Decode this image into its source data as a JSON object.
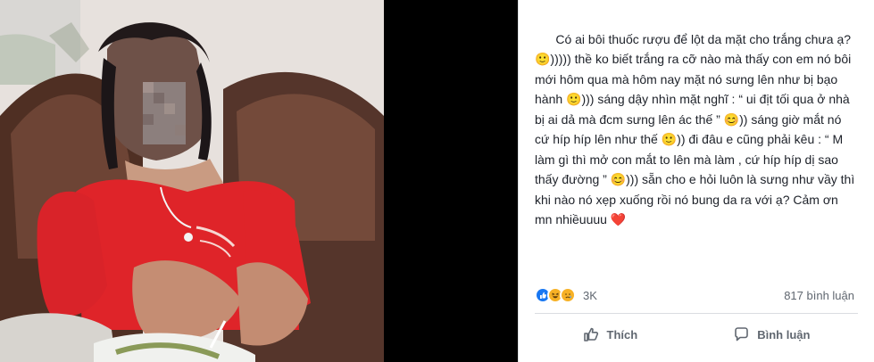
{
  "post": {
    "text_main": "Có ai bôi thuốc rượu để lột da mặt cho trắng chưa ạ? 🙂))))) thề ko biết trắng ra cỡ nào mà thấy con em nó bôi mới hôm qua mà hôm nay mặt nó sưng lên như bị bạo hành 🙂))) sáng dậy nhìn mặt nghĩ : “ ui địt tối qua ở nhà bị ai dả mà đcm sưng lên ác thế ” 😊)) sáng giờ mắt nó cứ híp híp lên như thế 🙂)) đi đâu e cũng phải kêu : “ M làm gì thì mở con mắt to lên mà làm , cứ híp híp dị sao thấy đường ” 😊))) sẵn cho e hỏi luôn là sưng như vầy thì khi nào nó xẹp xuống rồi nó bung da ra với ạ? Cảm ơn mn nhiềuuuu ",
    "heart": "❤️"
  },
  "reactions": {
    "count": "3K",
    "comments": "817 bình luận",
    "icons": [
      "like-icon",
      "haha-icon",
      "sad-icon"
    ],
    "colors": {
      "like": "#1877f2",
      "haha": "#f7b125",
      "sad": "#f7b125"
    }
  },
  "actions": {
    "like_label": "Thích",
    "comment_label": "Bình luận"
  },
  "colors": {
    "text": "#1d2129",
    "secondary": "#606770",
    "divider": "#dadde1",
    "photo_bg": "#000000"
  }
}
